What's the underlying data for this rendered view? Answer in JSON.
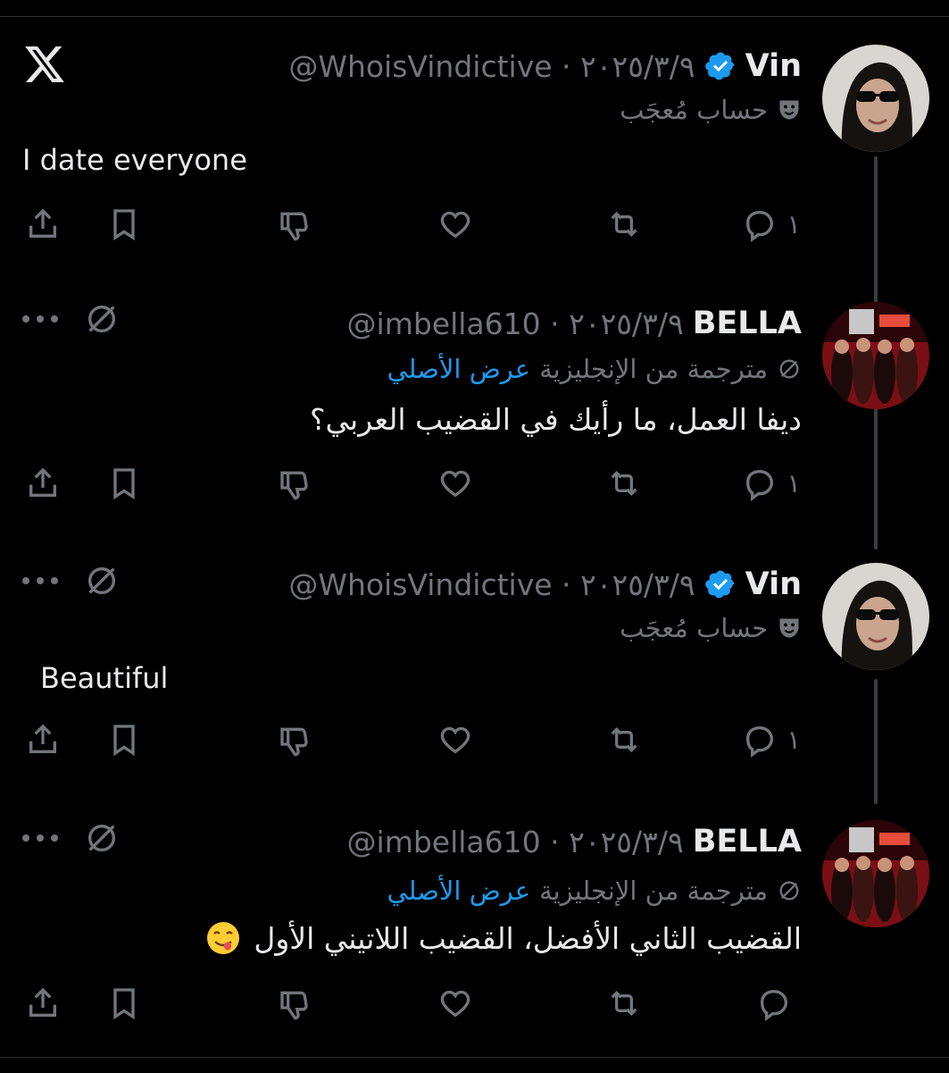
{
  "app": {
    "logo_icon": "x-logo-icon",
    "accent": "#1d9bf0",
    "verified_color": "#1d9bf0"
  },
  "posts": [
    {
      "name": "Vin",
      "verified": true,
      "handle_date": "@WhoisVindictive · ٢٠٢٥/٣/٩",
      "label_icon": "theater-masks-icon",
      "label": "حساب مُعجَب",
      "text": "I date everyone",
      "reply_count": "١"
    },
    {
      "name": "BELLA",
      "verified": false,
      "handle_date": "@imbella610 · ٢٠٢٥/٣/٩",
      "translated_label": "مترجمة من الإنجليزية",
      "show_original": "عرض الأصلي",
      "text": "ديفا العمل، ما رأيك في القضيب العربي؟",
      "reply_count": "١"
    },
    {
      "name": "Vin",
      "verified": true,
      "handle_date": "@WhoisVindictive · ٢٠٢٥/٣/٩",
      "label_icon": "theater-masks-icon",
      "label": "حساب مُعجَب",
      "text": "Beautiful",
      "reply_count": "١"
    },
    {
      "name": "BELLA",
      "verified": false,
      "handle_date": "@imbella610 · ٢٠٢٥/٣/٩",
      "translated_label": "مترجمة من الإنجليزية",
      "show_original": "عرض الأصلي",
      "text": "القضيب الثاني الأفضل، القضيب اللاتيني الأول",
      "emoji_icon": "face-savoring-food-emoji",
      "reply_count": ""
    }
  ],
  "action_icons": [
    "reply-icon",
    "repost-icon",
    "like-icon",
    "dislike-icon",
    "bookmark-icon",
    "share-icon"
  ]
}
